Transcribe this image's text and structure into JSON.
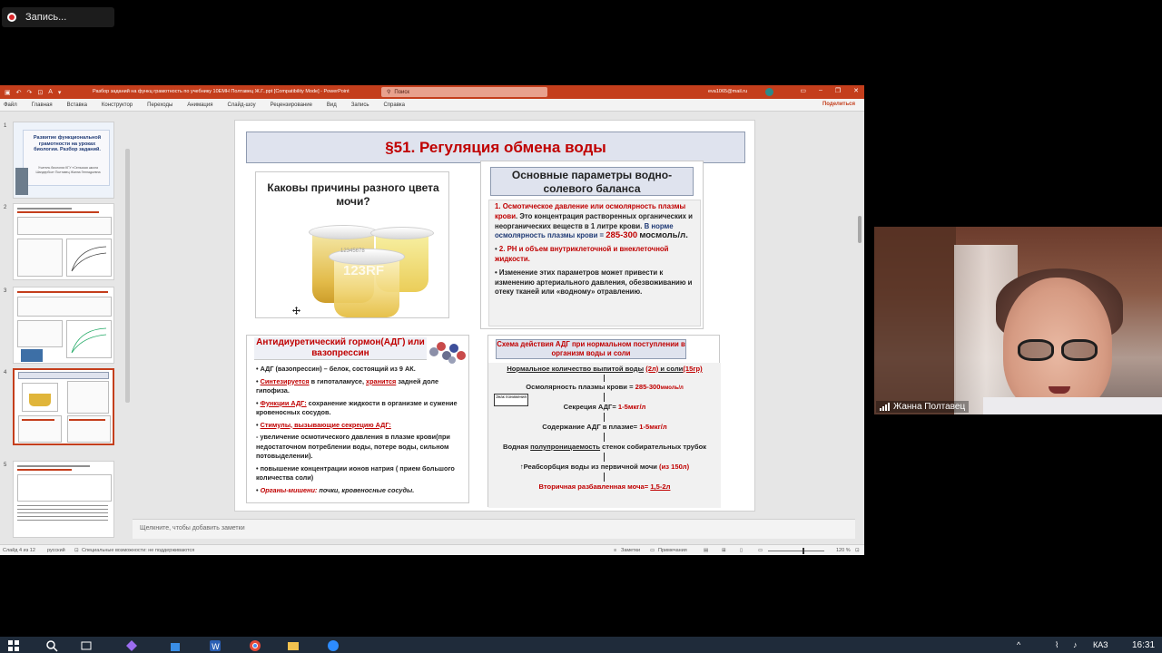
{
  "recording": {
    "label": "Запись..."
  },
  "window": {
    "title": "Разбор заданий на функц грамотность по учебнику 10ЕМН Полтавец Ж.Г..ppt [Compatibility Mode]  -  PowerPoint",
    "search_placeholder": "Поиск",
    "user_email": "eva1065@mail.ru",
    "accent": "#c43e1c"
  },
  "ribbon": {
    "tabs": [
      "Файл",
      "Главная",
      "Вставка",
      "Конструктор",
      "Переходы",
      "Анимация",
      "Слайд-шоу",
      "Рецензирование",
      "Вид",
      "Запись",
      "Справка"
    ],
    "share_label": "Поделиться"
  },
  "thumbnails": {
    "numbers": [
      "1",
      "2",
      "3",
      "4",
      "5"
    ],
    "selected": "4",
    "slide1_title": "Развитие функциональной грамотности на уроках биологии. Разбор заданий.",
    "slide1_author": "Учитель биологии КГУ «Сельская школа Шандербоз» Полтавец Жанна Геннадьевна"
  },
  "slide": {
    "title": "§51. Регуляция обмена воды",
    "question": "Каковы причины разного цвета мочи?",
    "watermark": "123RF",
    "watermark_number": "12345678",
    "params_title": "Основные параметры водно-солевого баланса",
    "params": {
      "p1_num": "1.",
      "p1_red": "Осмотическое давление или осмолярность плазмы крови",
      "p1_text": ". Это концентрация растворенных органических и неорганических веществ в 1 литре крови.",
      "p1_norm": "В норме осмолярность плазмы крови =",
      "p1_value": "285-300",
      "p1_unit": "мосмоль/л.",
      "p2_num": "2.",
      "p2_red": "РН и объем внутриклеточной и внеклеточной жидкости.",
      "p3": "Изменение этих параметров может привести к изменению артериального давления, обезвоживанию и отеку тканей или «водному» отравлению."
    },
    "adg_title": "Антидиуретический гормон(АДГ) или вазопрессин",
    "adg": {
      "i1": "АДГ (вазопрессин) – белок, состоящий из 9 АК.",
      "i2_red": "Синтезируется",
      "i2_text1": " в гипоталамусе, ",
      "i2_red2": "хранится",
      "i2_text2": " задней доле гипофиза.",
      "i3_red": "Функции АДГ:",
      "i3_text": " сохранение жидкости в организме и сужение кровеносных сосудов.",
      "i4_red": "Стимулы, вызывающие секрецию АДГ:",
      "i5": "- увеличение осмотического давления в плазме крови(при недостаточном потреблении воды, потере воды, сильном потовыделении).",
      "i6": "повышение концентрации ионов натрия ( прием большого количества соли)",
      "i7_red": "Органы-мишени:",
      "i7_text": " почки, кровеносные сосуды."
    },
    "scheme_title": "Схема действия АДГ при нормальном поступлении в организм воды и соли",
    "scheme": {
      "r1": "Нормальное количество выпитой воды",
      "r1_a": "(2л)",
      "r1_b": " и соли",
      "r1_c": "(15гр)",
      "r2": "Осмолярность плазмы крови = ",
      "r2_v": "285-300",
      "r2_u": "ммоль/л",
      "r3": "Секреция АДГ= ",
      "r3_v": "1-5мкг/л",
      "r4": "Содержание АДГ в плазме= ",
      "r4_v": "1-5мкг/л",
      "r5": "Водная ",
      "r5_u": "полупроницаемость",
      "r5_t": " стенок собирательных трубок",
      "r6": "Реабсорбция воды из первичной мочи ",
      "r6_v": "(из 150л)",
      "r7": "Вторичная разбавленная моча= ",
      "r7_v": "1,5-2л",
      "small_box": "Знак понижения"
    }
  },
  "notes_placeholder": "Щелкните, чтобы добавить заметки",
  "status": {
    "slide": "Слайд 4 из 12",
    "language": "русский",
    "accessibility": "Специальные возможности: не поддерживаются",
    "notes": "Заметки",
    "comments": "Примечания",
    "zoom": "120 %"
  },
  "video": {
    "participant": "Жанна Полтавец"
  },
  "taskbar": {
    "time": "16:31",
    "lang": "КАЗ"
  }
}
